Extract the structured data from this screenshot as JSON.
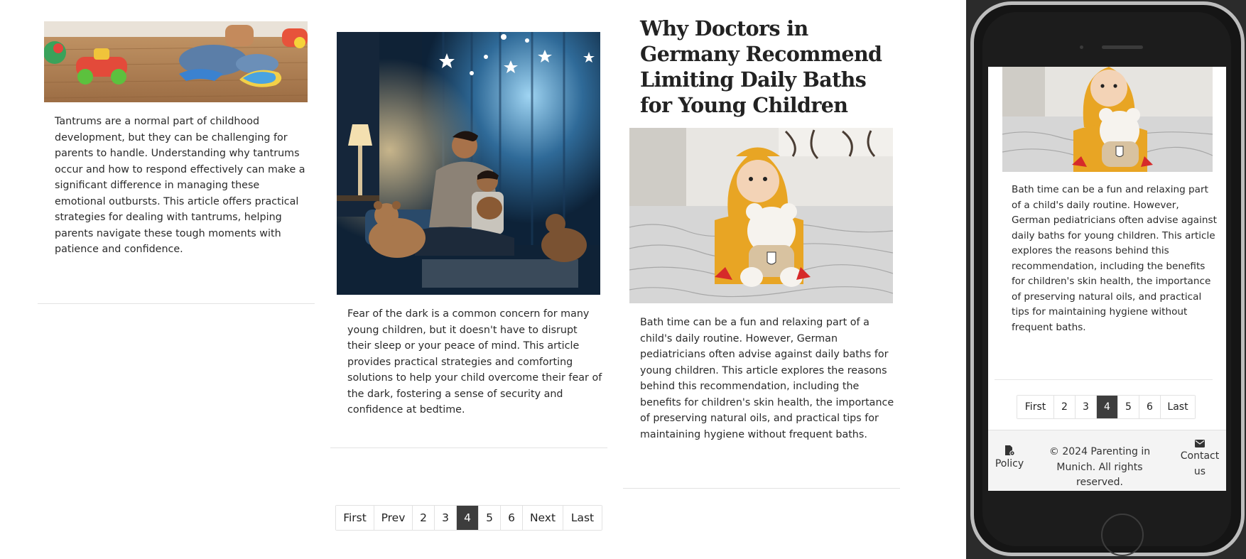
{
  "column1": {
    "excerpt": "Tantrums are a normal part of childhood development, but they can be challenging for parents to handle. Understanding why tantrums occur and how to respond effectively can make a significant difference in managing these emotional outbursts. This article offers practical strategies for dealing with tantrums, helping parents navigate these tough moments with patience and confidence."
  },
  "column2": {
    "excerpt": "Fear of the dark is a common concern for many young children, but it doesn't have to disrupt their sleep or your peace of mind. This article provides practical strategies and comforting solutions to help your child overcome their fear of the dark, fostering a sense of security and confidence at bedtime."
  },
  "column3": {
    "title": "Why Doctors in Germany Recommend Limiting Daily Baths for Young Children",
    "excerpt": "Bath time can be a fun and relaxing part of a child's daily routine. However, German pediatricians often advise against daily baths for young children. This article explores the reasons behind this recommendation, including the benefits for children's skin health, the importance of preserving natural oils, and practical tips for maintaining hygiene without frequent baths."
  },
  "pagination": {
    "first": "First",
    "prev": "Prev",
    "pages": [
      "2",
      "3",
      "4",
      "5",
      "6"
    ],
    "current": "4",
    "next": "Next",
    "last": "Last"
  },
  "mobile": {
    "excerpt": "Bath time can be a fun and relaxing part of a child's daily routine. However, German pediatricians often advise against daily baths for young children. This article explores the reasons behind this recommendation, including the benefits for children's skin health, the importance of preserving natural oils, and practical tips for maintaining hygiene without frequent baths.",
    "pagination": {
      "first": "First",
      "pages": [
        "2",
        "3",
        "4",
        "5",
        "6"
      ],
      "current": "4",
      "last": "Last"
    },
    "footer": {
      "policy": "Policy",
      "copyright": "© 2024 Parenting in Munich. All rights reserved.",
      "contact": "Contact us",
      "policy_icon": "document-gear-icon",
      "contact_icon": "envelope-icon"
    }
  },
  "colors": {
    "active_page": "#3d3d3d",
    "divider": "#e3e3e3",
    "phone_frame": "#151515"
  }
}
